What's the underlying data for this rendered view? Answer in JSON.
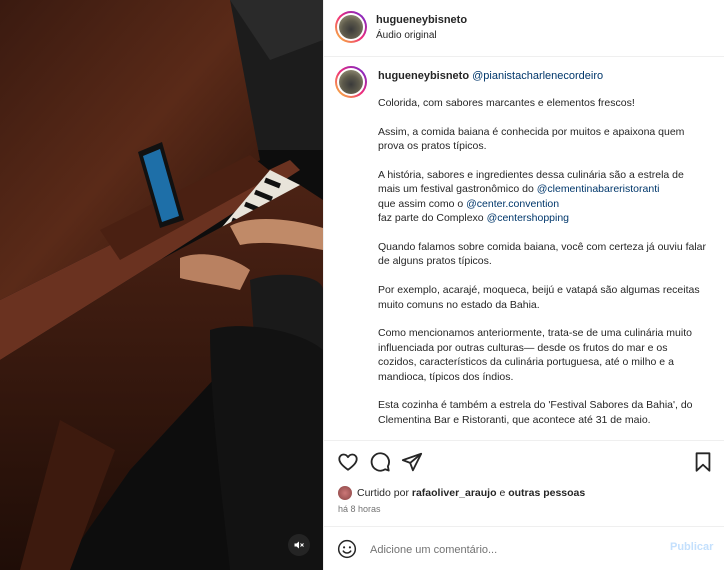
{
  "header": {
    "username": "hugueneybisneto",
    "audio": "Áudio original"
  },
  "caption": {
    "username": "hugueneybisneto",
    "mention": "@pianistacharlenecordeiro",
    "p1": "Colorida, com sabores marcantes e elementos frescos!",
    "p2": "Assim, a comida baiana é conhecida por muitos e apaixona quem prova os pratos típicos.",
    "p3_a": "A história, sabores e ingredientes dessa culinária são a estrela de mais um festival gastronômico do ",
    "p3_m1": "@clementinabareristoranti",
    "p3_b": " que assim como o ",
    "p3_m2": "@center.convention",
    "p3_c": "faz parte do Complexo ",
    "p3_m3": "@centershopping",
    "p4": "Quando falamos sobre comida baiana, você com certeza já ouviu falar de alguns pratos típicos.",
    "p5": "Por exemplo, acarajé, moqueca, beijú e vatapá são algumas receitas muito comuns no estado da Bahia.",
    "p6": "Como mencionamos anteriormente, trata-se de uma culinária muito influenciada por outras culturas— desde os frutos do mar e os cozidos, característicos da culinária portuguesa, até o milho e a mandioca, típicos dos índios.",
    "p7": "Esta cozinha é também a estrela do 'Festival Sabores da Bahia', do Clementina Bar e Ristoranti, que acontece até 31 de maio."
  },
  "likes": {
    "prefix": "Curtido por ",
    "user": "rafaoliver_araujo",
    "middle": " e ",
    "others": "outras pessoas"
  },
  "time": "há 8 horas",
  "comment": {
    "placeholder": "Adicione um comentário...",
    "publish": "Publicar"
  },
  "colors": {
    "mention": "#00376b",
    "publish_disabled": "#c4e0fd",
    "text": "#262626",
    "muted": "#737373"
  },
  "icons": {
    "like": "heart-icon",
    "comment": "comment-icon",
    "share": "paper-plane-icon",
    "save": "bookmark-icon",
    "emoji": "emoji-icon",
    "mute": "muted-speaker-icon"
  }
}
